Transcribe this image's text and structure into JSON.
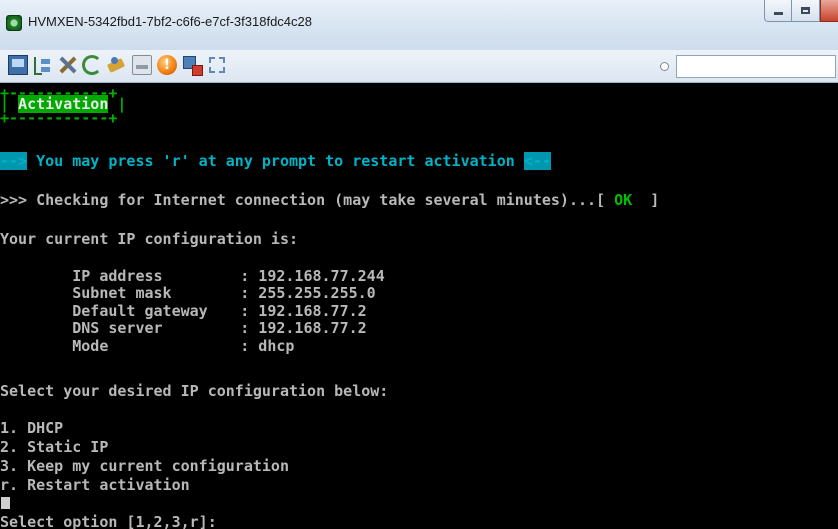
{
  "window": {
    "title": "HVMXEN-5342fbd1-7bf2-c6f6-e7cf-3f318fdc4c28"
  },
  "toolbar": {
    "buttons": [
      {
        "name": "console-icon"
      },
      {
        "name": "tree-icon"
      },
      {
        "name": "tools-icon"
      },
      {
        "name": "refresh-icon"
      },
      {
        "name": "settings-icon"
      },
      {
        "name": "media-icon"
      },
      {
        "name": "alert-icon"
      },
      {
        "name": "network-icon"
      },
      {
        "name": "fullscreen-icon"
      }
    ],
    "search_value": ""
  },
  "console": {
    "box_top": "+-----------+",
    "box_side": "|",
    "box_title": "Activation",
    "hint_prefix": "-->",
    "hint_text": " You may press 'r' at any prompt to restart activation ",
    "hint_suffix": "<--",
    "check_text": ">>> Checking for Internet connection (may take several minutes)...[ ",
    "check_status": "OK",
    "check_end": "  ]",
    "current_header": "Your current IP configuration is:",
    "config": [
      {
        "label": "IP address",
        "value": ": 192.168.77.244"
      },
      {
        "label": "Subnet mask",
        "value": ": 255.255.255.0"
      },
      {
        "label": "Default gateway",
        "value": ": 192.168.77.2"
      },
      {
        "label": "DNS server",
        "value": ": 192.168.77.2"
      },
      {
        "label": "Mode",
        "value": ": dhcp"
      }
    ],
    "select_header": "Select your desired IP configuration below:",
    "options": [
      "1. DHCP",
      "2. Static IP",
      "3. Keep my current configuration",
      "r. Restart activation"
    ],
    "prompt": "Select option [1,2,3,r]:"
  },
  "colors": {
    "console_bg": "#000000",
    "console_text": "#b8b8b8",
    "green": "#00b000",
    "cyan": "#00b4c8"
  }
}
